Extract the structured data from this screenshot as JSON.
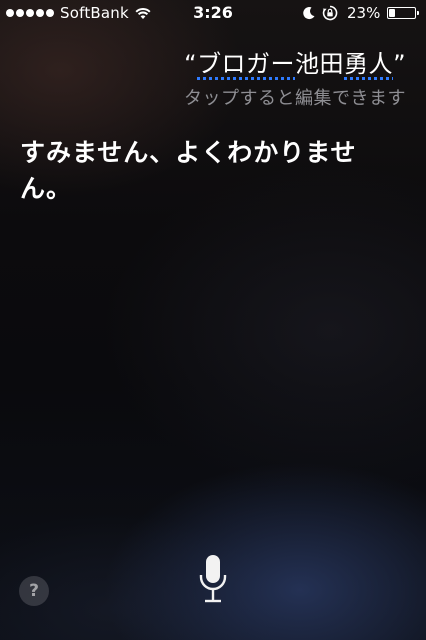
{
  "status_bar": {
    "carrier": "SoftBank",
    "time": "3:26",
    "battery_percent": "23%",
    "battery_level": 0.23,
    "signal_bars": 5,
    "icons": [
      "signal-dots",
      "wifi-icon",
      "do-not-disturb-moon-icon",
      "rotation-lock-icon",
      "battery-icon"
    ]
  },
  "siri": {
    "query_open_quote": "“",
    "query_part1": "ブロガー",
    "query_part2": "池田",
    "query_part3": "勇人",
    "query_close_quote": "”",
    "edit_hint": "タップすると編集できます",
    "response": "すみません、よくわかりません。"
  },
  "controls": {
    "help_label": "?",
    "mic_icon": "microphone-icon"
  }
}
